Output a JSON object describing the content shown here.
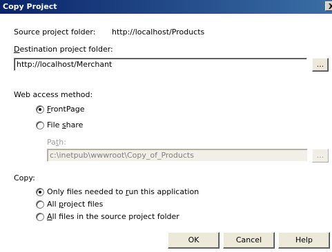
{
  "window": {
    "title": "Copy Project",
    "close_label": "X"
  },
  "source": {
    "label": "Source project folder:",
    "value": "http://localhost/Products"
  },
  "destination": {
    "label_accel": "D",
    "label_rest": "estination project folder:",
    "value": "http://localhost/Merchant",
    "browse_label": "..."
  },
  "web_access": {
    "label": "Web access method:",
    "frontpage": {
      "accel": "F",
      "rest": "rontPage",
      "selected": true
    },
    "fileshare": {
      "pre": "File ",
      "accel": "s",
      "rest": "hare",
      "selected": false
    },
    "path": {
      "pre": "Pa",
      "accel": "t",
      "rest": "h:",
      "value": "c:\\inetpub\\wwwroot\\Copy_of_Products",
      "browse_label": "..."
    }
  },
  "copy": {
    "label": "Copy:",
    "options": [
      {
        "pre": "Only files needed to ",
        "accel": "r",
        "rest": "un this application",
        "selected": true
      },
      {
        "pre": "All ",
        "accel": "p",
        "rest": "roject files",
        "selected": false
      },
      {
        "pre": "",
        "accel": "A",
        "rest": "ll files in the source project folder",
        "selected": false
      }
    ]
  },
  "buttons": {
    "ok": "OK",
    "cancel": "Cancel",
    "help": "Help"
  }
}
